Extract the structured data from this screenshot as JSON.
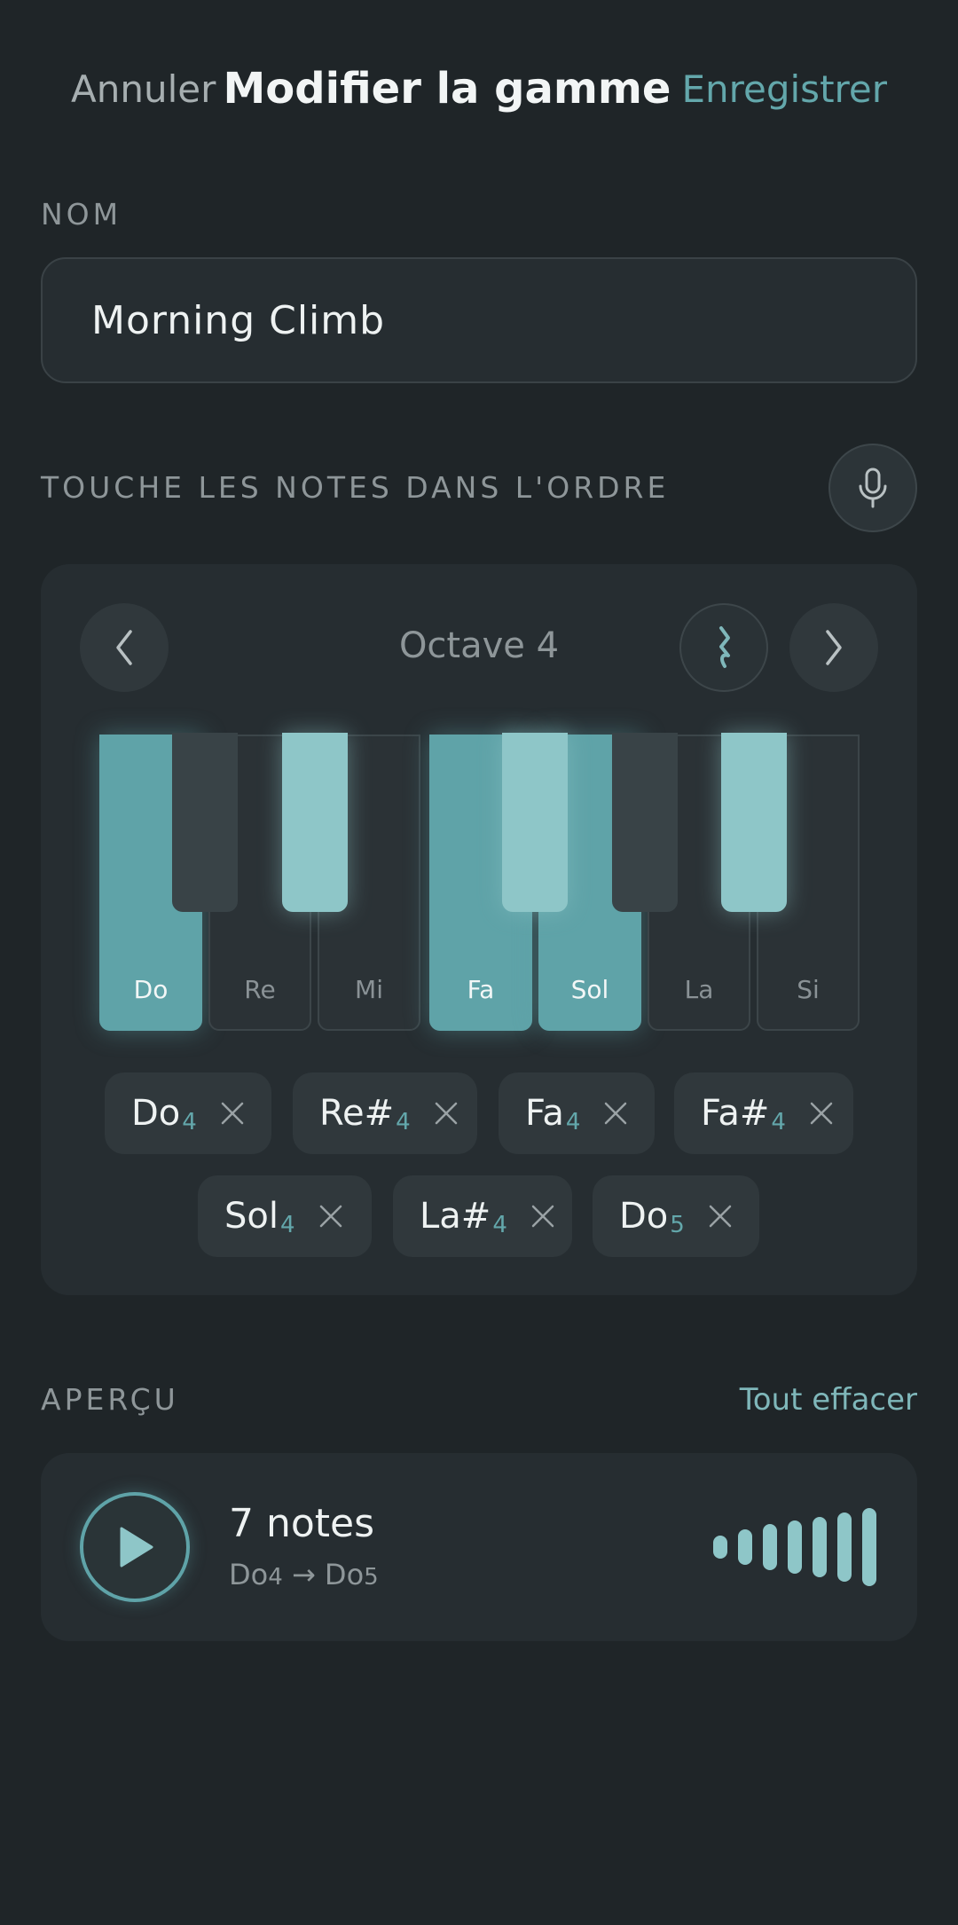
{
  "header": {
    "cancel": "Annuler",
    "title": "Modifier la gamme",
    "save": "Enregistrer"
  },
  "name": {
    "label": "NOM",
    "value": "Morning Climb"
  },
  "notes_section": {
    "label": "TOUCHE LES NOTES DANS L'ORDRE"
  },
  "keyboard": {
    "octave_label": "Octave 4",
    "white_keys": [
      {
        "label": "Do",
        "active": true
      },
      {
        "label": "Re",
        "active": false
      },
      {
        "label": "Mi",
        "active": false
      },
      {
        "label": "Fa",
        "active": true
      },
      {
        "label": "Sol",
        "active": true
      },
      {
        "label": "La",
        "active": false
      },
      {
        "label": "Si",
        "active": false
      }
    ],
    "black_keys_active": [
      false,
      true,
      true,
      false,
      true
    ]
  },
  "chips": [
    {
      "note": "Do",
      "octave": "4"
    },
    {
      "note": "Re#",
      "octave": "4"
    },
    {
      "note": "Fa",
      "octave": "4"
    },
    {
      "note": "Fa#",
      "octave": "4"
    },
    {
      "note": "Sol",
      "octave": "4"
    },
    {
      "note": "La#",
      "octave": "4"
    },
    {
      "note": "Do",
      "octave": "5"
    }
  ],
  "preview": {
    "label": "APERÇU",
    "clear_all": "Tout effacer",
    "count": "7 notes",
    "range_start": "Do",
    "range_start_oct": "4",
    "arrow": "→",
    "range_end": "Do",
    "range_end_oct": "5"
  },
  "colors": {
    "accent": "#5fa3a8",
    "accent_light": "#8ec6c8",
    "background": "#1f2528",
    "card": "#262d31"
  },
  "icons": [
    "mic-icon",
    "chevron-left-icon",
    "rest-icon",
    "chevron-right-icon",
    "close-icon",
    "play-icon",
    "waveform-icon"
  ]
}
